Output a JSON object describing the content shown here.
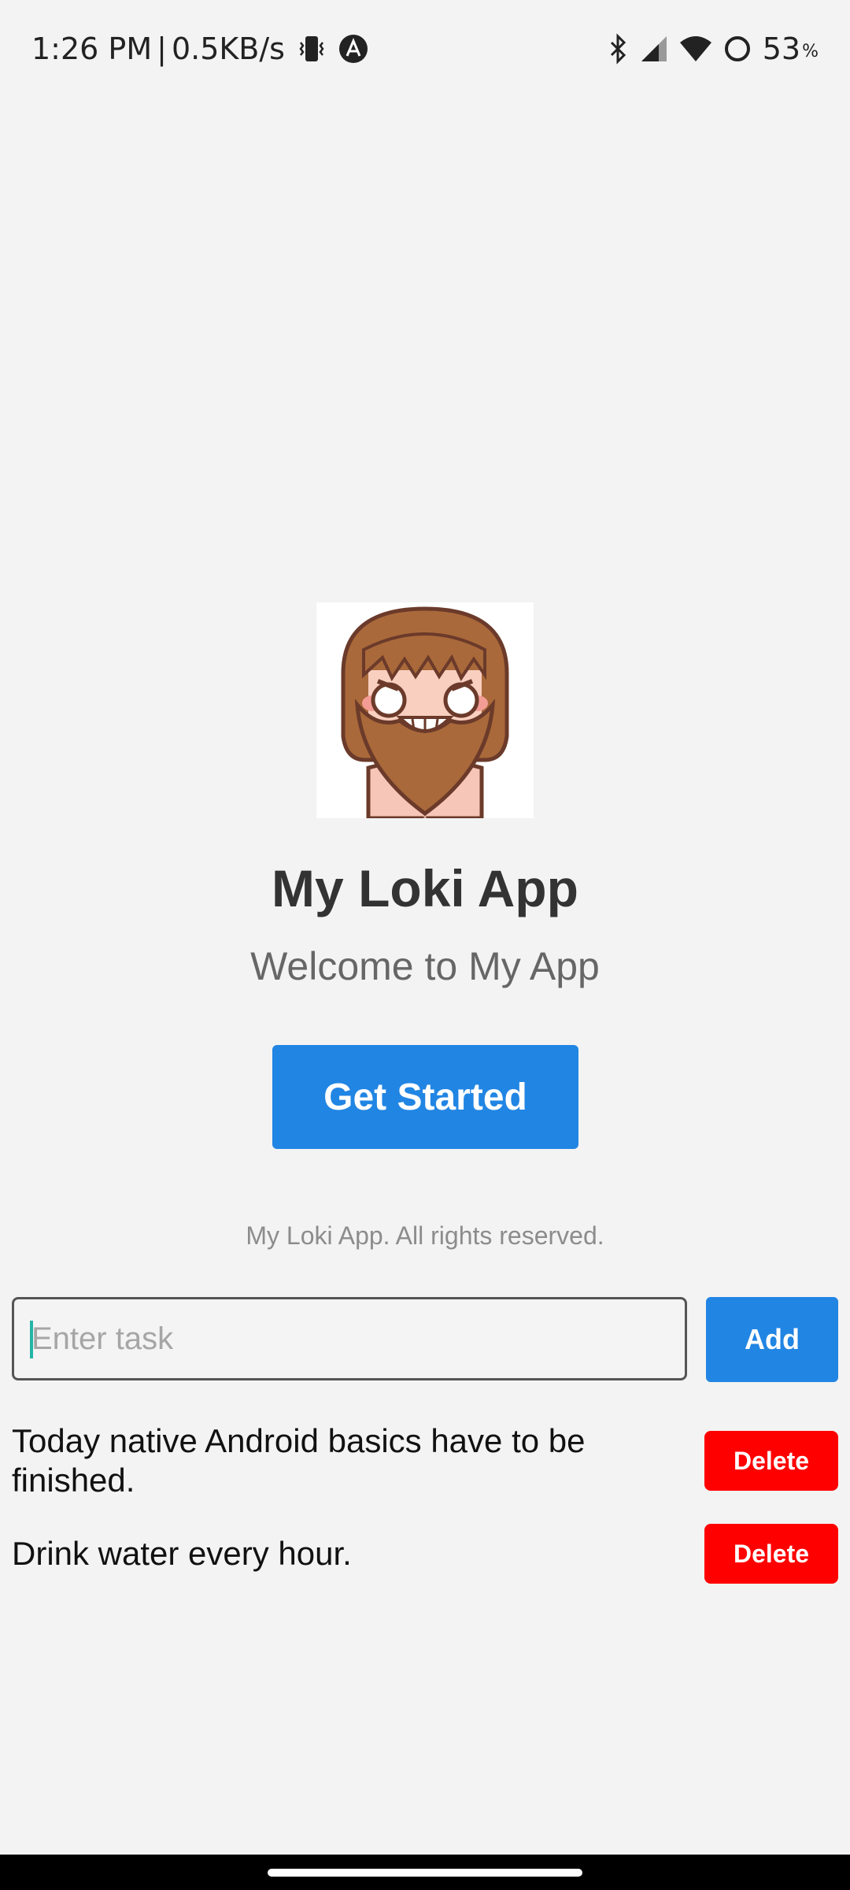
{
  "status_bar": {
    "time": "1:26 PM",
    "separator": "|",
    "network_speed": "0.5KB/s",
    "battery_percent": "53",
    "battery_unit": "%"
  },
  "app": {
    "title": "My Loki App",
    "subtitle": "Welcome to My App",
    "get_started_label": "Get Started",
    "footer": "My Loki App. All rights reserved."
  },
  "task_form": {
    "placeholder": "Enter task",
    "value": "",
    "add_label": "Add"
  },
  "tasks": [
    {
      "text": "Today native Android basics have to be finished.",
      "delete_label": "Delete"
    },
    {
      "text": "Drink water every hour.",
      "delete_label": "Delete"
    }
  ],
  "colors": {
    "primary": "#2185e3",
    "danger": "#ff0000",
    "background": "#f3f3f3"
  }
}
